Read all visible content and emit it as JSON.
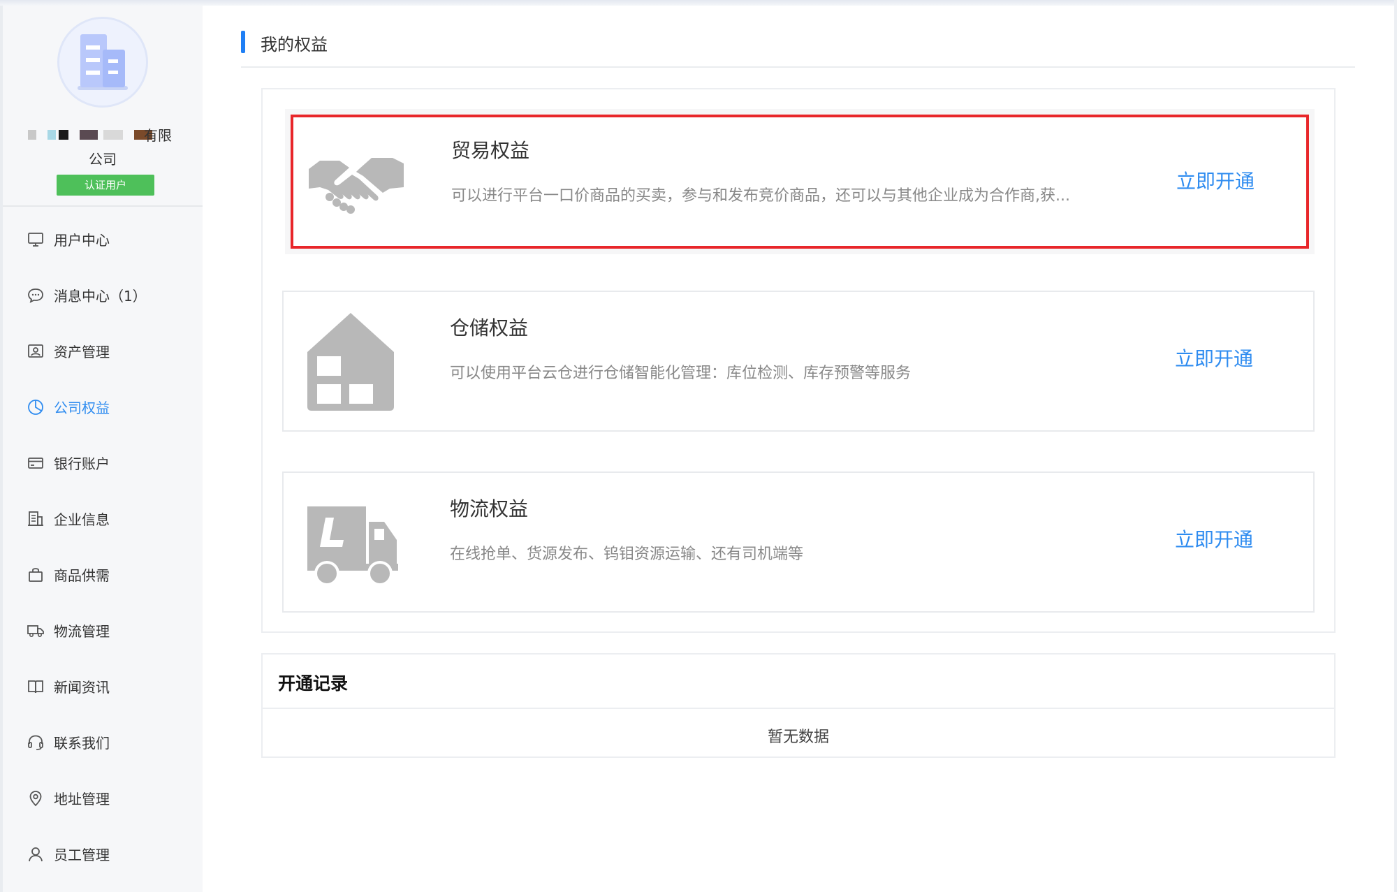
{
  "sidebar": {
    "company_name_suffix": "有限",
    "company_name_line2": "公司",
    "verified_badge": "认证用户",
    "items": [
      {
        "label": "用户中心",
        "icon": "monitor-icon"
      },
      {
        "label": "消息中心（1）",
        "icon": "chat-bubble-icon"
      },
      {
        "label": "资产管理",
        "icon": "asset-icon"
      },
      {
        "label": "公司权益",
        "icon": "pie-chart-icon",
        "active": true
      },
      {
        "label": "银行账户",
        "icon": "credit-card-icon"
      },
      {
        "label": "企业信息",
        "icon": "building-icon"
      },
      {
        "label": "商品供需",
        "icon": "shopping-bag-icon"
      },
      {
        "label": "物流管理",
        "icon": "truck-icon"
      },
      {
        "label": "新闻资讯",
        "icon": "book-icon"
      },
      {
        "label": "联系我们",
        "icon": "headset-icon"
      },
      {
        "label": "地址管理",
        "icon": "location-pin-icon"
      },
      {
        "label": "员工管理",
        "icon": "user-icon"
      }
    ]
  },
  "main": {
    "section_title": "我的权益",
    "benefits": [
      {
        "title": "贸易权益",
        "description": "可以进行平台一口价商品的买卖，参与和发布竞价商品，还可以与其他企业成为合作商,获...",
        "action": "立即开通",
        "icon": "handshake-icon",
        "highlighted": true
      },
      {
        "title": "仓储权益",
        "description": "可以使用平台云仓进行仓储智能化管理：库位检测、库存预警等服务",
        "action": "立即开通",
        "icon": "warehouse-icon",
        "highlighted": false
      },
      {
        "title": "物流权益",
        "description": "在线抢单、货源发布、钨钼资源运输、还有司机端等",
        "action": "立即开通",
        "icon": "truck-icon",
        "highlighted": false
      }
    ],
    "records": {
      "title": "开通记录",
      "empty_text": "暂无数据"
    }
  },
  "colors": {
    "accent": "#2f8cf0",
    "highlight_border": "#e8262a",
    "verified_green": "#4ec05a",
    "section_bar": "#1f7ff5"
  }
}
